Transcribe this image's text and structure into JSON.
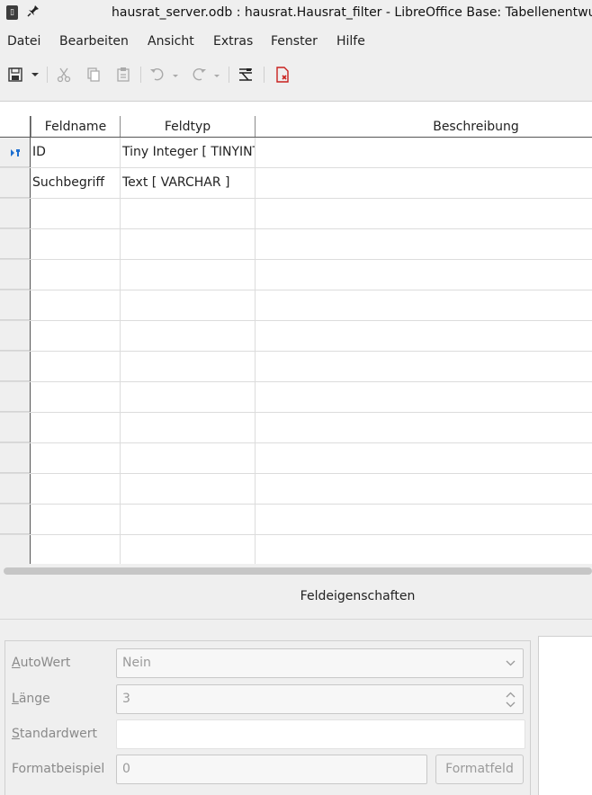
{
  "window": {
    "title": "hausrat_server.odb : hausrat.Hausrat_filter - LibreOffice Base: Tabellenentwurf"
  },
  "menu": [
    "Datei",
    "Bearbeiten",
    "Ansicht",
    "Extras",
    "Fenster",
    "Hilfe"
  ],
  "toolbar": {
    "icons": [
      "save-icon",
      "dropdown-arrow-icon",
      "cut-icon",
      "copy-icon",
      "paste-icon",
      "undo-icon",
      "redo-icon",
      "index-design-icon",
      "primary-key-icon"
    ]
  },
  "table": {
    "columns": [
      "Feldname",
      "Feldtyp",
      "Beschreibung"
    ],
    "rows": [
      {
        "name": "ID",
        "type": "Tiny Integer [ TINYINT ]",
        "description": "",
        "primary_key": true
      },
      {
        "name": "Suchbegriff",
        "type": "Text [ VARCHAR ]",
        "description": "",
        "primary_key": false
      }
    ]
  },
  "properties": {
    "heading": "Feldeigenschaften",
    "autowert_label": "AutoWert",
    "autowert_value": "Nein",
    "laenge_label": "Länge",
    "laenge_value": "3",
    "standardwert_label": "Standardwert",
    "standardwert_value": "",
    "formatbeispiel_label": "Formatbeispiel",
    "formatbeispiel_value": "0",
    "formatfeld_button": "Formatfeld"
  },
  "colors": {
    "accent_red": "#c9211e",
    "pk_blue": "#1e6fd0"
  }
}
